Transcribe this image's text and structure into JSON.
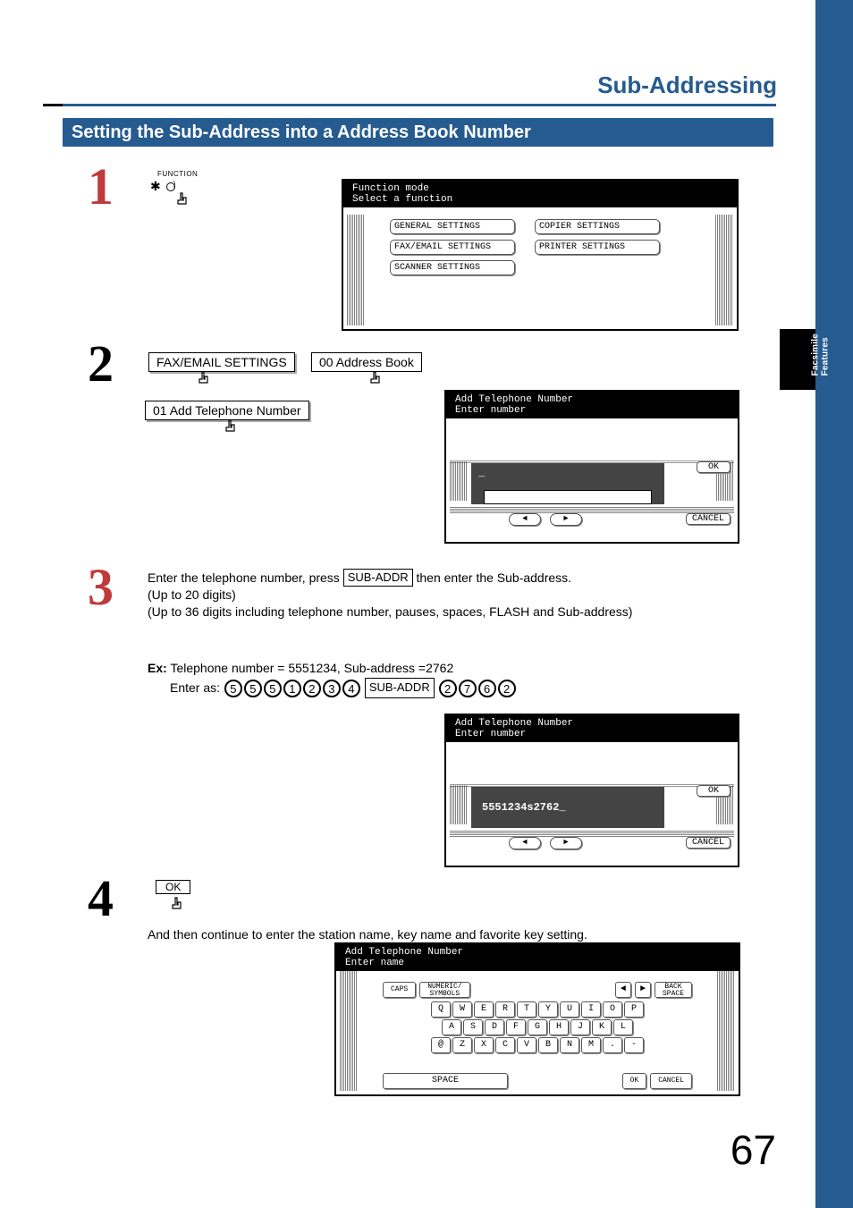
{
  "section_title": "Sub-Addressing",
  "heading": "Setting the Sub-Address into a Address Book Number",
  "side_tab": "Facsimile\nFeatures",
  "page_number": "67",
  "step1": {
    "func_label": "FUNCTION",
    "func_symbol": "✱",
    "lcd_title": "Function mode",
    "lcd_subtitle": "Select a function",
    "buttons": [
      "GENERAL SETTINGS",
      "COPIER SETTINGS",
      "FAX/EMAIL SETTINGS",
      "PRINTER SETTINGS",
      "SCANNER SETTINGS"
    ]
  },
  "step2": {
    "btn1": "FAX/EMAIL SETTINGS",
    "btn2": "00 Address Book",
    "btn3": "01 Add Telephone Number",
    "lcd_title": "Add Telephone Number",
    "lcd_subtitle": "Enter number",
    "input_placeholder": "_",
    "ok": "OK",
    "cancel": "CANCEL"
  },
  "step3": {
    "text_pre": "Enter the telephone number, press ",
    "subaddr": "SUB-ADDR",
    "text_post": " then enter the Sub-address.",
    "line2": "(Up to 20 digits)",
    "line3": "(Up to 36 digits including telephone number, pauses, spaces, FLASH and Sub-address)",
    "ex_label": "Ex:",
    "ex_text": "Telephone number = 5551234, Sub-address =2762",
    "enter_as": "Enter as:",
    "seq1": [
      "5",
      "5",
      "5",
      "1",
      "2",
      "3",
      "4"
    ],
    "seq2": [
      "2",
      "7",
      "6",
      "2"
    ],
    "lcd_title": "Add Telephone Number",
    "lcd_subtitle": "Enter number",
    "input_value": "5551234s2762_",
    "ok": "OK",
    "cancel": "CANCEL"
  },
  "step4": {
    "ok_label": "OK",
    "text": "And then continue to enter the station name, key name and favorite key setting.",
    "lcd_title": "Add Telephone Number",
    "lcd_subtitle": "Enter name",
    "top_buttons": [
      "CAPS",
      "NUMERIC/\nSYMBOLS"
    ],
    "top_right": [
      "◄",
      "►",
      "BACK\nSPACE"
    ],
    "row1": [
      "Q",
      "W",
      "E",
      "R",
      "T",
      "Y",
      "U",
      "I",
      "O",
      "P"
    ],
    "row2": [
      "A",
      "S",
      "D",
      "F",
      "G",
      "H",
      "J",
      "K",
      "L"
    ],
    "row3": [
      "@",
      "Z",
      "X",
      "C",
      "V",
      "B",
      "N",
      "M",
      ".",
      "-"
    ],
    "bottom": {
      "space": "SPACE",
      "ok": "OK",
      "cancel": "CANCEL"
    }
  }
}
